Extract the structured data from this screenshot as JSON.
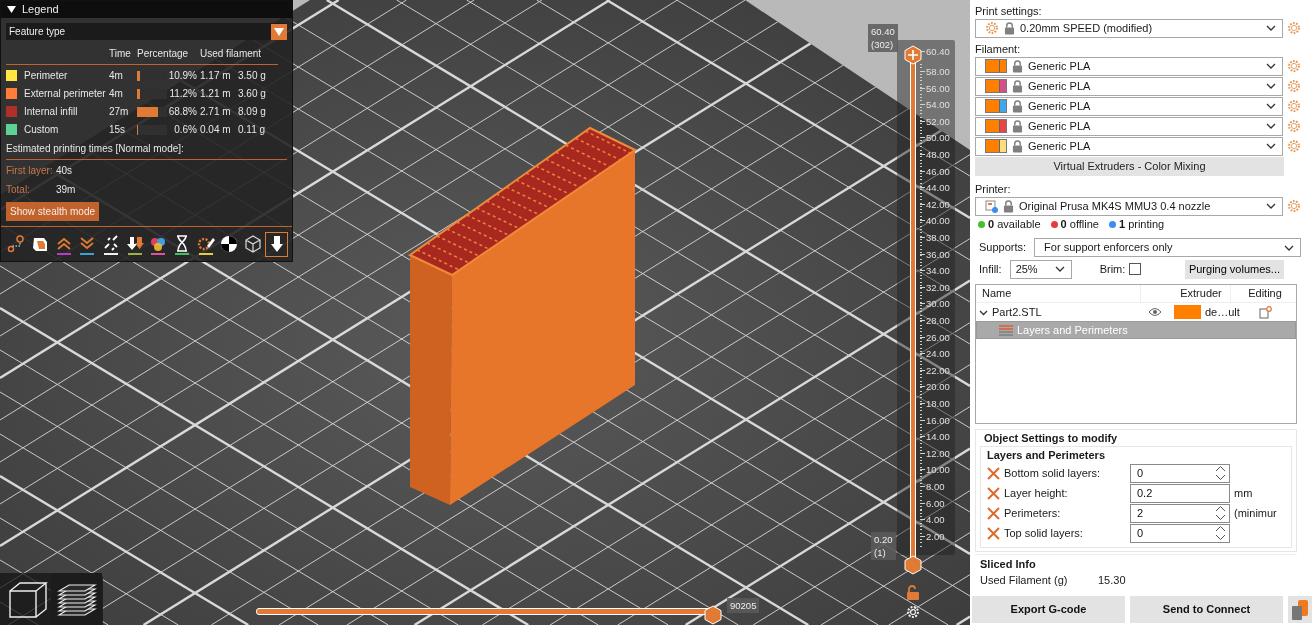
{
  "legend": {
    "title": "Legend",
    "expanded": true,
    "view_type": "Feature type",
    "columns": [
      "Time",
      "Percentage",
      "Used filament"
    ],
    "features": [
      {
        "name": "Perimeter",
        "color": "#ffe640",
        "time": "4m",
        "level": 0.109,
        "percentage": "10.9%",
        "length": "1.17 m",
        "weight": "3.50 g"
      },
      {
        "name": "External perimeter",
        "color": "#ff7d38",
        "time": "4m",
        "level": 0.112,
        "percentage": "11.2%",
        "length": "1.21 m",
        "weight": "3.60 g"
      },
      {
        "name": "Internal infill",
        "color": "#b03029",
        "time": "27m",
        "level": 0.688,
        "percentage": "68.8%",
        "length": "2.71 m",
        "weight": "8.09 g"
      },
      {
        "name": "Custom",
        "color": "#5ed194",
        "time": "15s",
        "level": 0.006,
        "percentage": "0.6%",
        "length": "0.04 m",
        "weight": "0.11 g"
      }
    ],
    "estimate_title": "Estimated printing times [Normal mode]:",
    "estimates": [
      {
        "label": "First layer:",
        "value": "40s"
      },
      {
        "label": "Total:",
        "value": "39m"
      }
    ],
    "stealth_button": "Show stealth mode",
    "toolbar": [
      {
        "kind": "route",
        "selected": false
      },
      {
        "kind": "shell",
        "selected": false
      },
      {
        "kind": "chevrons_up",
        "selected": false
      },
      {
        "kind": "chevrons_down",
        "selected": false
      },
      {
        "kind": "broken_link",
        "selected": false
      },
      {
        "kind": "drop_arrow",
        "selected": false
      },
      {
        "kind": "color_circles",
        "selected": false
      },
      {
        "kind": "hourglass",
        "selected": false
      },
      {
        "kind": "gear_pencil",
        "selected": false
      },
      {
        "kind": "checker",
        "selected": false
      },
      {
        "kind": "cube",
        "selected": false
      },
      {
        "kind": "arrow_down",
        "selected": true
      }
    ]
  },
  "vertical_slider": {
    "upper": {
      "value": "60.40",
      "layer": "(302)",
      "level": 1
    },
    "lower": {
      "value": "0.20",
      "layer": "(1)",
      "level": 0
    },
    "ticks": [
      "60.40",
      "58.00",
      "56.00",
      "54.00",
      "52.00",
      "50.00",
      "48.00",
      "46.00",
      "44.00",
      "42.00",
      "40.00",
      "38.00",
      "36.00",
      "34.00",
      "32.00",
      "30.00",
      "28.00",
      "26.00",
      "24.00",
      "22.00",
      "20.00",
      "18.00",
      "16.00",
      "14.00",
      "12.00",
      "10.00",
      "8.00",
      "6.00",
      "4.00",
      "2.00"
    ]
  },
  "horizontal_slider": {
    "value": "90205",
    "level": 1
  },
  "view_buttons": [
    {
      "kind": "perspective",
      "selected": false
    },
    {
      "kind": "layers",
      "selected": true
    }
  ],
  "sidebar": {
    "print_settings": {
      "label": "Print settings:",
      "value": "0.20mm SPEED (modified)"
    },
    "filament": {
      "label": "Filament:",
      "items": [
        {
          "name": "Generic PLA",
          "color": "#ff8000"
        },
        {
          "name": "Generic PLA",
          "color": "#d2508c"
        },
        {
          "name": "Generic PLA",
          "color": "#3ca8f0"
        },
        {
          "name": "Generic PLA",
          "color": "#e84646"
        },
        {
          "name": "Generic PLA",
          "color": "#f8e080"
        }
      ]
    },
    "color_mixing_button": "Virtual Extruders - Color Mixing",
    "printer": {
      "label": "Printer:",
      "value": "Original Prusa MK4S MMU3 0.4 nozzle"
    },
    "printer_status": [
      {
        "count": "0",
        "label": "available",
        "color": "#44c02c"
      },
      {
        "count": "0",
        "label": "offline",
        "color": "#e83a3a"
      },
      {
        "count": "1",
        "label": "printing",
        "color": "#3a8ef0"
      }
    ],
    "supports": {
      "label": "Supports:",
      "value": "For support enforcers only"
    },
    "infill": {
      "label": "Infill:",
      "value": "25%"
    },
    "brim": {
      "label": "Brim:",
      "checked": false
    },
    "purging_button": "Purging volumes...",
    "object_list": {
      "columns": [
        "Name",
        "Extruder",
        "Editing"
      ],
      "items": [
        {
          "name": "Part2.STL",
          "expanded": true,
          "selected": false,
          "extruder": "de…ult",
          "children": [
            {
              "name": "Layers and Perimeters",
              "selected": true
            }
          ]
        }
      ]
    },
    "object_settings": {
      "title": "Object Settings to modify",
      "group": "Layers and Perimeters",
      "fields": [
        {
          "kind": "spin",
          "label": "Bottom solid layers:",
          "value": "0"
        },
        {
          "kind": "text",
          "label": "Layer height:",
          "value": "0.2",
          "unit": "mm"
        },
        {
          "kind": "spin",
          "label": "Perimeters:",
          "value": "2",
          "unit": "(minimur"
        },
        {
          "kind": "spin",
          "label": "Top solid layers:",
          "value": "0"
        }
      ]
    },
    "sliced_info": {
      "title": "Sliced Info",
      "rows": [
        {
          "label": "Used Filament (g)",
          "value": "15.30"
        }
      ]
    },
    "buttons": [
      "Export G-code",
      "Send to Connect"
    ]
  }
}
